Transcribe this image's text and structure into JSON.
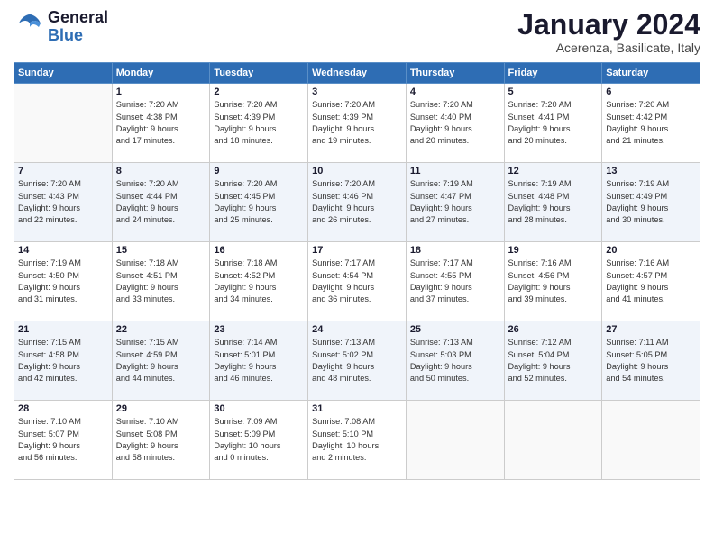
{
  "header": {
    "logo": {
      "general": "General",
      "blue": "Blue"
    },
    "title": "January 2024",
    "location": "Acerenza, Basilicate, Italy"
  },
  "days_header": [
    "Sunday",
    "Monday",
    "Tuesday",
    "Wednesday",
    "Thursday",
    "Friday",
    "Saturday"
  ],
  "weeks": [
    [
      {
        "num": "",
        "info": ""
      },
      {
        "num": "1",
        "info": "Sunrise: 7:20 AM\nSunset: 4:38 PM\nDaylight: 9 hours\nand 17 minutes."
      },
      {
        "num": "2",
        "info": "Sunrise: 7:20 AM\nSunset: 4:39 PM\nDaylight: 9 hours\nand 18 minutes."
      },
      {
        "num": "3",
        "info": "Sunrise: 7:20 AM\nSunset: 4:39 PM\nDaylight: 9 hours\nand 19 minutes."
      },
      {
        "num": "4",
        "info": "Sunrise: 7:20 AM\nSunset: 4:40 PM\nDaylight: 9 hours\nand 20 minutes."
      },
      {
        "num": "5",
        "info": "Sunrise: 7:20 AM\nSunset: 4:41 PM\nDaylight: 9 hours\nand 20 minutes."
      },
      {
        "num": "6",
        "info": "Sunrise: 7:20 AM\nSunset: 4:42 PM\nDaylight: 9 hours\nand 21 minutes."
      }
    ],
    [
      {
        "num": "7",
        "info": "Sunrise: 7:20 AM\nSunset: 4:43 PM\nDaylight: 9 hours\nand 22 minutes."
      },
      {
        "num": "8",
        "info": "Sunrise: 7:20 AM\nSunset: 4:44 PM\nDaylight: 9 hours\nand 24 minutes."
      },
      {
        "num": "9",
        "info": "Sunrise: 7:20 AM\nSunset: 4:45 PM\nDaylight: 9 hours\nand 25 minutes."
      },
      {
        "num": "10",
        "info": "Sunrise: 7:20 AM\nSunset: 4:46 PM\nDaylight: 9 hours\nand 26 minutes."
      },
      {
        "num": "11",
        "info": "Sunrise: 7:19 AM\nSunset: 4:47 PM\nDaylight: 9 hours\nand 27 minutes."
      },
      {
        "num": "12",
        "info": "Sunrise: 7:19 AM\nSunset: 4:48 PM\nDaylight: 9 hours\nand 28 minutes."
      },
      {
        "num": "13",
        "info": "Sunrise: 7:19 AM\nSunset: 4:49 PM\nDaylight: 9 hours\nand 30 minutes."
      }
    ],
    [
      {
        "num": "14",
        "info": "Sunrise: 7:19 AM\nSunset: 4:50 PM\nDaylight: 9 hours\nand 31 minutes."
      },
      {
        "num": "15",
        "info": "Sunrise: 7:18 AM\nSunset: 4:51 PM\nDaylight: 9 hours\nand 33 minutes."
      },
      {
        "num": "16",
        "info": "Sunrise: 7:18 AM\nSunset: 4:52 PM\nDaylight: 9 hours\nand 34 minutes."
      },
      {
        "num": "17",
        "info": "Sunrise: 7:17 AM\nSunset: 4:54 PM\nDaylight: 9 hours\nand 36 minutes."
      },
      {
        "num": "18",
        "info": "Sunrise: 7:17 AM\nSunset: 4:55 PM\nDaylight: 9 hours\nand 37 minutes."
      },
      {
        "num": "19",
        "info": "Sunrise: 7:16 AM\nSunset: 4:56 PM\nDaylight: 9 hours\nand 39 minutes."
      },
      {
        "num": "20",
        "info": "Sunrise: 7:16 AM\nSunset: 4:57 PM\nDaylight: 9 hours\nand 41 minutes."
      }
    ],
    [
      {
        "num": "21",
        "info": "Sunrise: 7:15 AM\nSunset: 4:58 PM\nDaylight: 9 hours\nand 42 minutes."
      },
      {
        "num": "22",
        "info": "Sunrise: 7:15 AM\nSunset: 4:59 PM\nDaylight: 9 hours\nand 44 minutes."
      },
      {
        "num": "23",
        "info": "Sunrise: 7:14 AM\nSunset: 5:01 PM\nDaylight: 9 hours\nand 46 minutes."
      },
      {
        "num": "24",
        "info": "Sunrise: 7:13 AM\nSunset: 5:02 PM\nDaylight: 9 hours\nand 48 minutes."
      },
      {
        "num": "25",
        "info": "Sunrise: 7:13 AM\nSunset: 5:03 PM\nDaylight: 9 hours\nand 50 minutes."
      },
      {
        "num": "26",
        "info": "Sunrise: 7:12 AM\nSunset: 5:04 PM\nDaylight: 9 hours\nand 52 minutes."
      },
      {
        "num": "27",
        "info": "Sunrise: 7:11 AM\nSunset: 5:05 PM\nDaylight: 9 hours\nand 54 minutes."
      }
    ],
    [
      {
        "num": "28",
        "info": "Sunrise: 7:10 AM\nSunset: 5:07 PM\nDaylight: 9 hours\nand 56 minutes."
      },
      {
        "num": "29",
        "info": "Sunrise: 7:10 AM\nSunset: 5:08 PM\nDaylight: 9 hours\nand 58 minutes."
      },
      {
        "num": "30",
        "info": "Sunrise: 7:09 AM\nSunset: 5:09 PM\nDaylight: 10 hours\nand 0 minutes."
      },
      {
        "num": "31",
        "info": "Sunrise: 7:08 AM\nSunset: 5:10 PM\nDaylight: 10 hours\nand 2 minutes."
      },
      {
        "num": "",
        "info": ""
      },
      {
        "num": "",
        "info": ""
      },
      {
        "num": "",
        "info": ""
      }
    ]
  ]
}
